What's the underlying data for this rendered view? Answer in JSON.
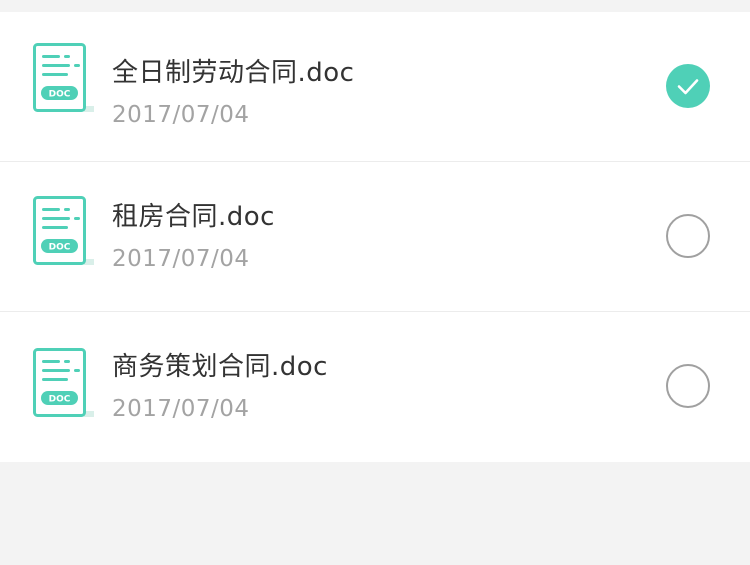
{
  "colors": {
    "accent": "#4fd0b7",
    "icon_teal": "#4fd0b7",
    "radio_border": "#a0a0a0",
    "name_text": "#333333",
    "date_text": "#a3a3a3",
    "background": "#f3f3f3"
  },
  "files": [
    {
      "name": "全日制劳动合同.doc",
      "date": "2017/07/04",
      "icon_label": "DOC",
      "icon": "doc-file-icon",
      "selected": true
    },
    {
      "name": "租房合同.doc",
      "date": "2017/07/04",
      "icon_label": "DOC",
      "icon": "doc-file-icon",
      "selected": false
    },
    {
      "name": "商务策划合同.doc",
      "date": "2017/07/04",
      "icon_label": "DOC",
      "icon": "doc-file-icon",
      "selected": false
    }
  ]
}
